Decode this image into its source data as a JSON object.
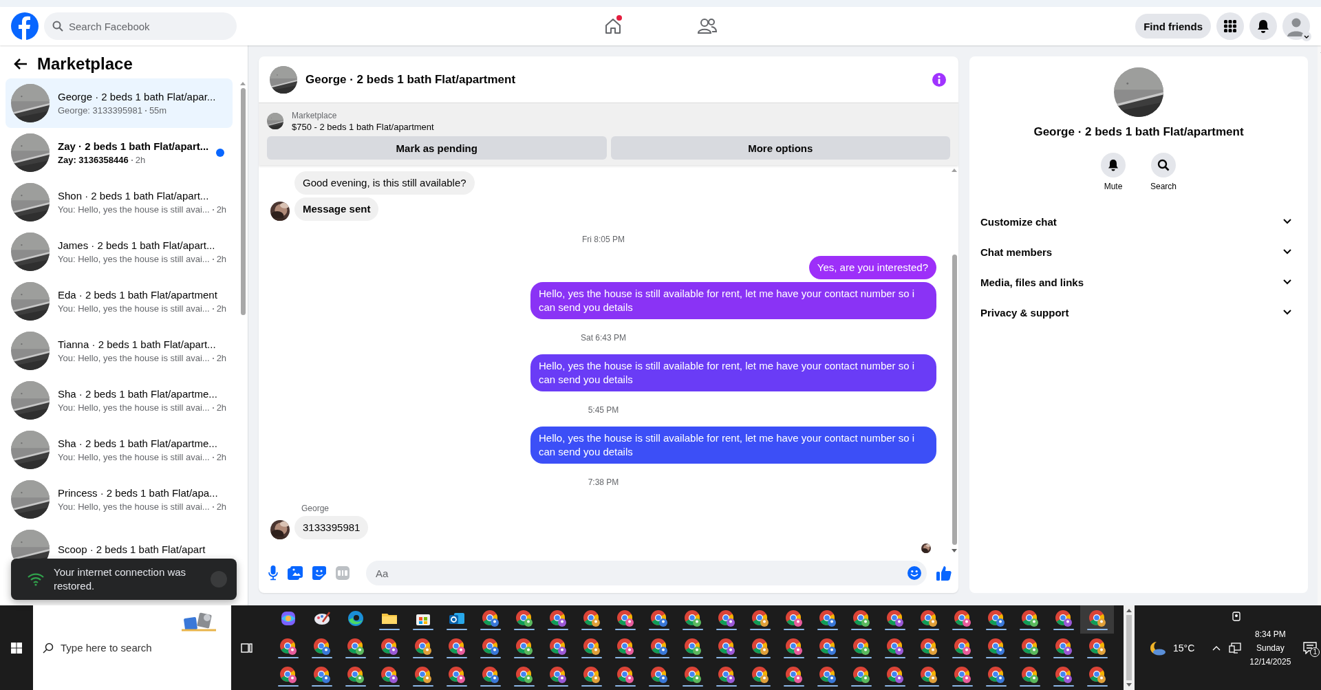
{
  "top_bar": {
    "search_placeholder": "Search Facebook",
    "home_badge": true,
    "find_friends": "Find friends"
  },
  "sidebar": {
    "title": "Marketplace",
    "conversations": [
      {
        "name": "George · 2 beds 1 bath Flat/apar...",
        "preview": "George: 3133395981",
        "time": "55m",
        "unread": false,
        "selected": true
      },
      {
        "name": "Zay · 2 beds 1 bath Flat/apart...",
        "preview": "Zay: 3136358446",
        "time": "2h",
        "unread": true,
        "selected": false
      },
      {
        "name": "Shon · 2 beds 1 bath Flat/apart...",
        "preview": "You: Hello, yes the house is still avai...",
        "time": "2h",
        "unread": false,
        "selected": false
      },
      {
        "name": "James · 2 beds 1 bath Flat/apart...",
        "preview": "You: Hello, yes the house is still avai...",
        "time": "2h",
        "unread": false,
        "selected": false
      },
      {
        "name": "Eda · 2 beds 1 bath Flat/apartment",
        "preview": "You: Hello, yes the house is still avai...",
        "time": "2h",
        "unread": false,
        "selected": false
      },
      {
        "name": "Tianna · 2 beds 1 bath Flat/apart...",
        "preview": "You: Hello, yes the house is still avai...",
        "time": "2h",
        "unread": false,
        "selected": false
      },
      {
        "name": "Sha · 2 beds 1 bath Flat/apartme...",
        "preview": "You: Hello, yes the house is still avai...",
        "time": "2h",
        "unread": false,
        "selected": false
      },
      {
        "name": "Sha · 2 beds 1 bath Flat/apartme...",
        "preview": "You: Hello, yes the house is still avai...",
        "time": "2h",
        "unread": false,
        "selected": false
      },
      {
        "name": "Princess · 2 beds 1 bath Flat/apa...",
        "preview": "You: Hello, yes the house is still avai...",
        "time": "2h",
        "unread": false,
        "selected": false
      },
      {
        "name": "Scoop · 2 beds 1 bath Flat/apart",
        "unread": false,
        "selected": false
      }
    ]
  },
  "toast": {
    "message": "Your internet connection was restored."
  },
  "chat": {
    "title": "George · 2 beds 1 bath Flat/apartment",
    "listing": {
      "source": "Marketplace",
      "title": "$750 - 2 beds 1 bath Flat/apartment"
    },
    "actions": [
      "Mark as pending",
      "More options"
    ],
    "messages": [
      {
        "kind": "incoming",
        "text": "Good evening, is this still available?",
        "bold": false,
        "avatar": false
      },
      {
        "kind": "incoming",
        "text": "Message sent",
        "bold": true,
        "avatar": true
      },
      {
        "kind": "timestamp",
        "text": "Fri 8:05 PM"
      },
      {
        "kind": "outgoing",
        "text": "Yes, are you interested?"
      },
      {
        "kind": "outgoing",
        "text": "Hello, yes the house is still available for rent, let me have your contact number so i can send you details"
      },
      {
        "kind": "timestamp",
        "text": "Sat 6:43 PM"
      },
      {
        "kind": "outgoing",
        "text": "Hello, yes the house is still available for rent, let me have your contact number so i can send you details"
      },
      {
        "kind": "timestamp",
        "text": "5:45 PM"
      },
      {
        "kind": "outgoing",
        "text": "Hello, yes the house is still available for rent, let me have your contact number so i can send you details"
      },
      {
        "kind": "timestamp",
        "text": "7:38 PM"
      },
      {
        "kind": "sender",
        "text": "George"
      },
      {
        "kind": "incoming",
        "text": "3133395981",
        "bold": false,
        "avatar": true
      },
      {
        "kind": "read_receipt"
      }
    ],
    "composer": {
      "placeholder": "Aa"
    }
  },
  "details": {
    "name": "George · 2 beds 1 bath Flat/apartment",
    "actions": [
      {
        "kind": "mute",
        "label": "Mute"
      },
      {
        "kind": "search",
        "label": "Search"
      }
    ],
    "sections": [
      {
        "label": "Customize chat",
        "expanded": false
      },
      {
        "label": "Chat members",
        "expanded": false
      },
      {
        "label": "Media, files and links",
        "expanded": false
      },
      {
        "label": "Privacy & support",
        "expanded": false
      }
    ]
  },
  "taskbar": {
    "search_placeholder": "Type here to search",
    "weather": "15°C",
    "time": "8:34 PM",
    "day": "Sunday",
    "date": "12/14/2025",
    "notifications": "1"
  }
}
